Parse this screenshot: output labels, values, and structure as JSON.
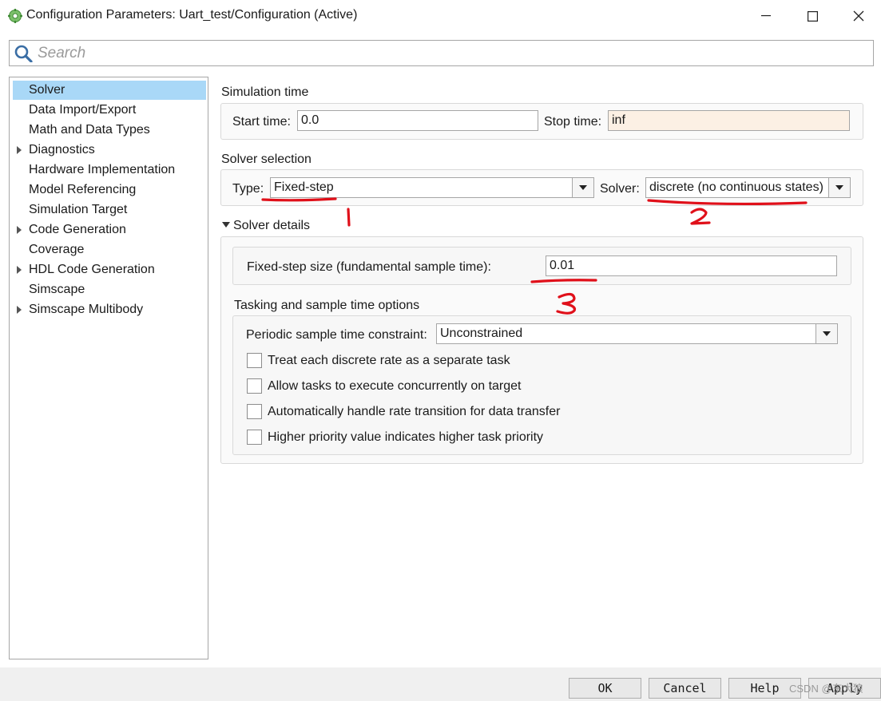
{
  "window": {
    "title": "Configuration Parameters: Uart_test/Configuration (Active)",
    "controls": {
      "minimize_icon": "minimize-icon",
      "maximize_icon": "maximize-icon",
      "close_icon": "close-icon"
    }
  },
  "search": {
    "placeholder": "Search"
  },
  "tree": {
    "items": [
      {
        "label": "Solver",
        "selected": true,
        "expandable": false
      },
      {
        "label": "Data Import/Export",
        "selected": false,
        "expandable": false
      },
      {
        "label": "Math and Data Types",
        "selected": false,
        "expandable": false
      },
      {
        "label": "Diagnostics",
        "selected": false,
        "expandable": true
      },
      {
        "label": "Hardware Implementation",
        "selected": false,
        "expandable": false
      },
      {
        "label": "Model Referencing",
        "selected": false,
        "expandable": false
      },
      {
        "label": "Simulation Target",
        "selected": false,
        "expandable": false
      },
      {
        "label": "Code Generation",
        "selected": false,
        "expandable": true
      },
      {
        "label": "Coverage",
        "selected": false,
        "expandable": false
      },
      {
        "label": "HDL Code Generation",
        "selected": false,
        "expandable": true
      },
      {
        "label": "Simscape",
        "selected": false,
        "expandable": false
      },
      {
        "label": "Simscape Multibody",
        "selected": false,
        "expandable": true
      }
    ]
  },
  "simulation_time": {
    "heading": "Simulation time",
    "start_label": "Start time:",
    "start_value": "0.0",
    "stop_label": "Stop time:",
    "stop_value": "inf"
  },
  "solver_selection": {
    "heading": "Solver selection",
    "type_label": "Type:",
    "type_value": "Fixed-step",
    "solver_label": "Solver:",
    "solver_value": "discrete (no continuous states)"
  },
  "solver_details": {
    "heading": "Solver details",
    "fixed_step_label": "Fixed-step size (fundamental sample time):",
    "fixed_step_value": "0.01",
    "tasking_heading": "Tasking and sample time options",
    "periodic_label": "Periodic sample time constraint:",
    "periodic_value": "Unconstrained",
    "checkboxes": [
      {
        "label": "Treat each discrete rate as a separate task",
        "checked": false
      },
      {
        "label": "Allow tasks to execute concurrently on target",
        "checked": false
      },
      {
        "label": "Automatically handle rate transition for data transfer",
        "checked": false
      },
      {
        "label": "Higher priority value indicates higher task priority",
        "checked": false
      }
    ]
  },
  "annotations": {
    "mark_1": "1",
    "mark_2": "2",
    "mark_3": "3",
    "color": "#e0101a"
  },
  "buttons": {
    "ok": "OK",
    "cancel": "Cancel",
    "help": "Help",
    "apply": "Apply"
  },
  "watermark": "CSDN @东大狼",
  "colors": {
    "selection": "#a9d8f7",
    "warn_field": "#fcf0e4",
    "annotation": "#e0101a"
  }
}
